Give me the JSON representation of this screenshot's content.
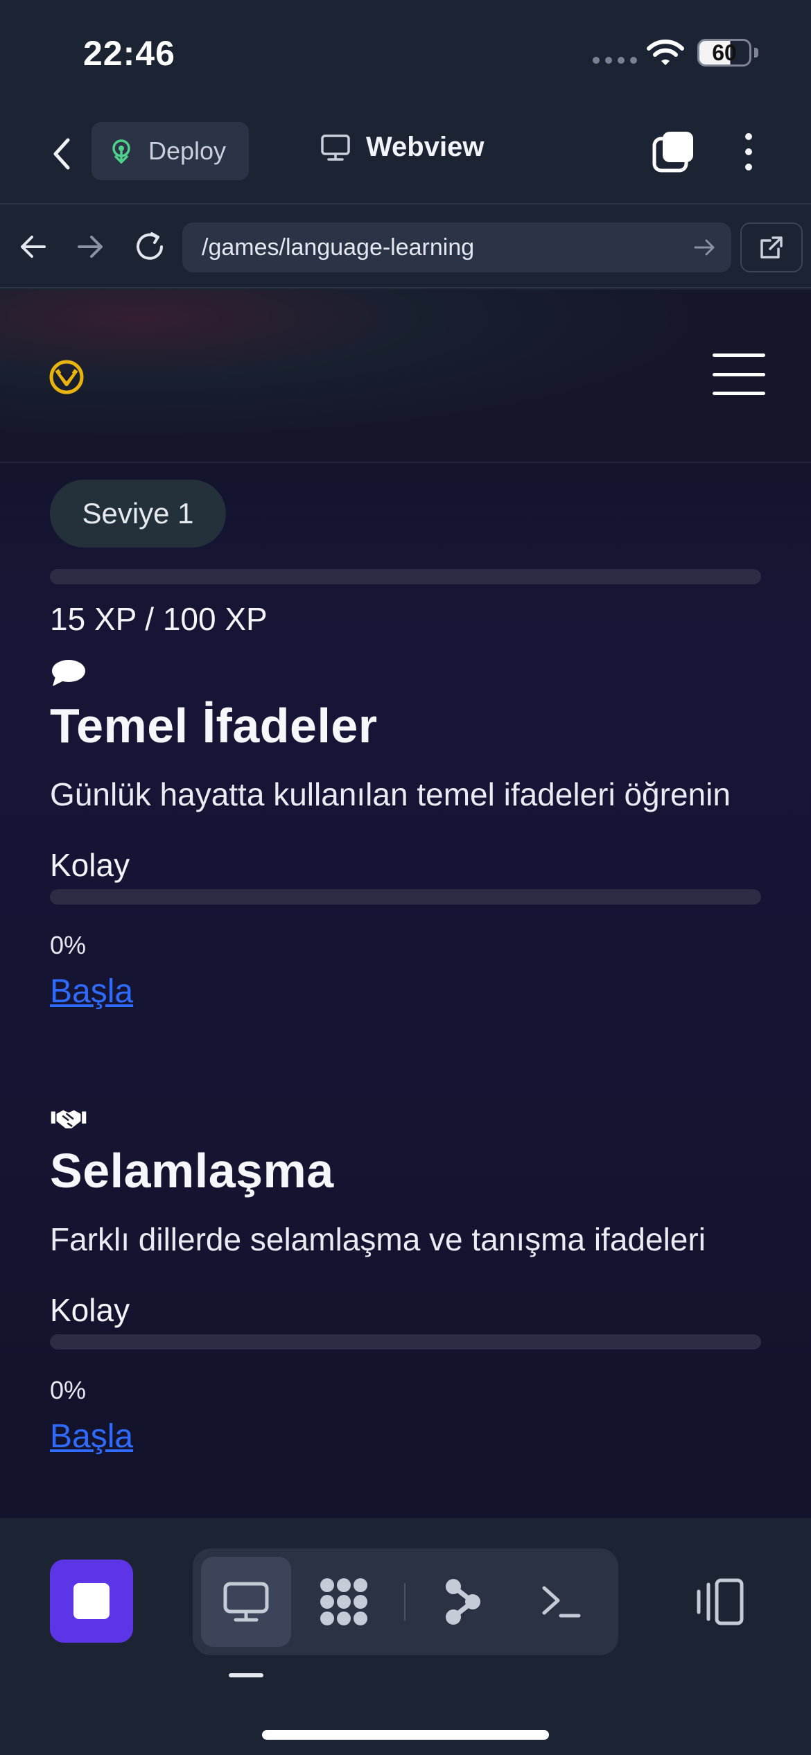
{
  "status_bar": {
    "time": "22:46",
    "battery": "60"
  },
  "app_header": {
    "deploy_label": "Deploy",
    "webview_label": "Webview"
  },
  "url_bar": {
    "url": "/games/language-learning"
  },
  "page": {
    "level_label": "Seviye 1",
    "xp_text": "15 XP / 100 XP",
    "xp_progress": 0.15,
    "lessons": [
      {
        "icon": "speech-bubble-icon",
        "title": "Temel İfadeler",
        "description": "Günlük hayatta kullanılan temel ifadeleri öğrenin",
        "difficulty": "Kolay",
        "progress_text": "0%",
        "progress": 0,
        "action": "Başla"
      },
      {
        "icon": "handshake-icon",
        "title": "Selamlaşma",
        "description": "Farklı dillerde selamlaşma ve tanışma ifadeleri",
        "difficulty": "Kolay",
        "progress_text": "0%",
        "progress": 0,
        "action": "Başla"
      }
    ]
  },
  "colors": {
    "app_bg": "#1c2333",
    "content_bg": "#161536",
    "accent_stop": "#5b35e6",
    "link": "#2f6bff",
    "deploy_icon": "#4fd18b",
    "logo": "#e8b30f"
  },
  "toolbar": {
    "items": [
      "stop-icon",
      "desktop-icon",
      "grid-icon",
      "node-icon",
      "terminal-icon",
      "panel-icon"
    ],
    "active": "desktop-icon"
  }
}
